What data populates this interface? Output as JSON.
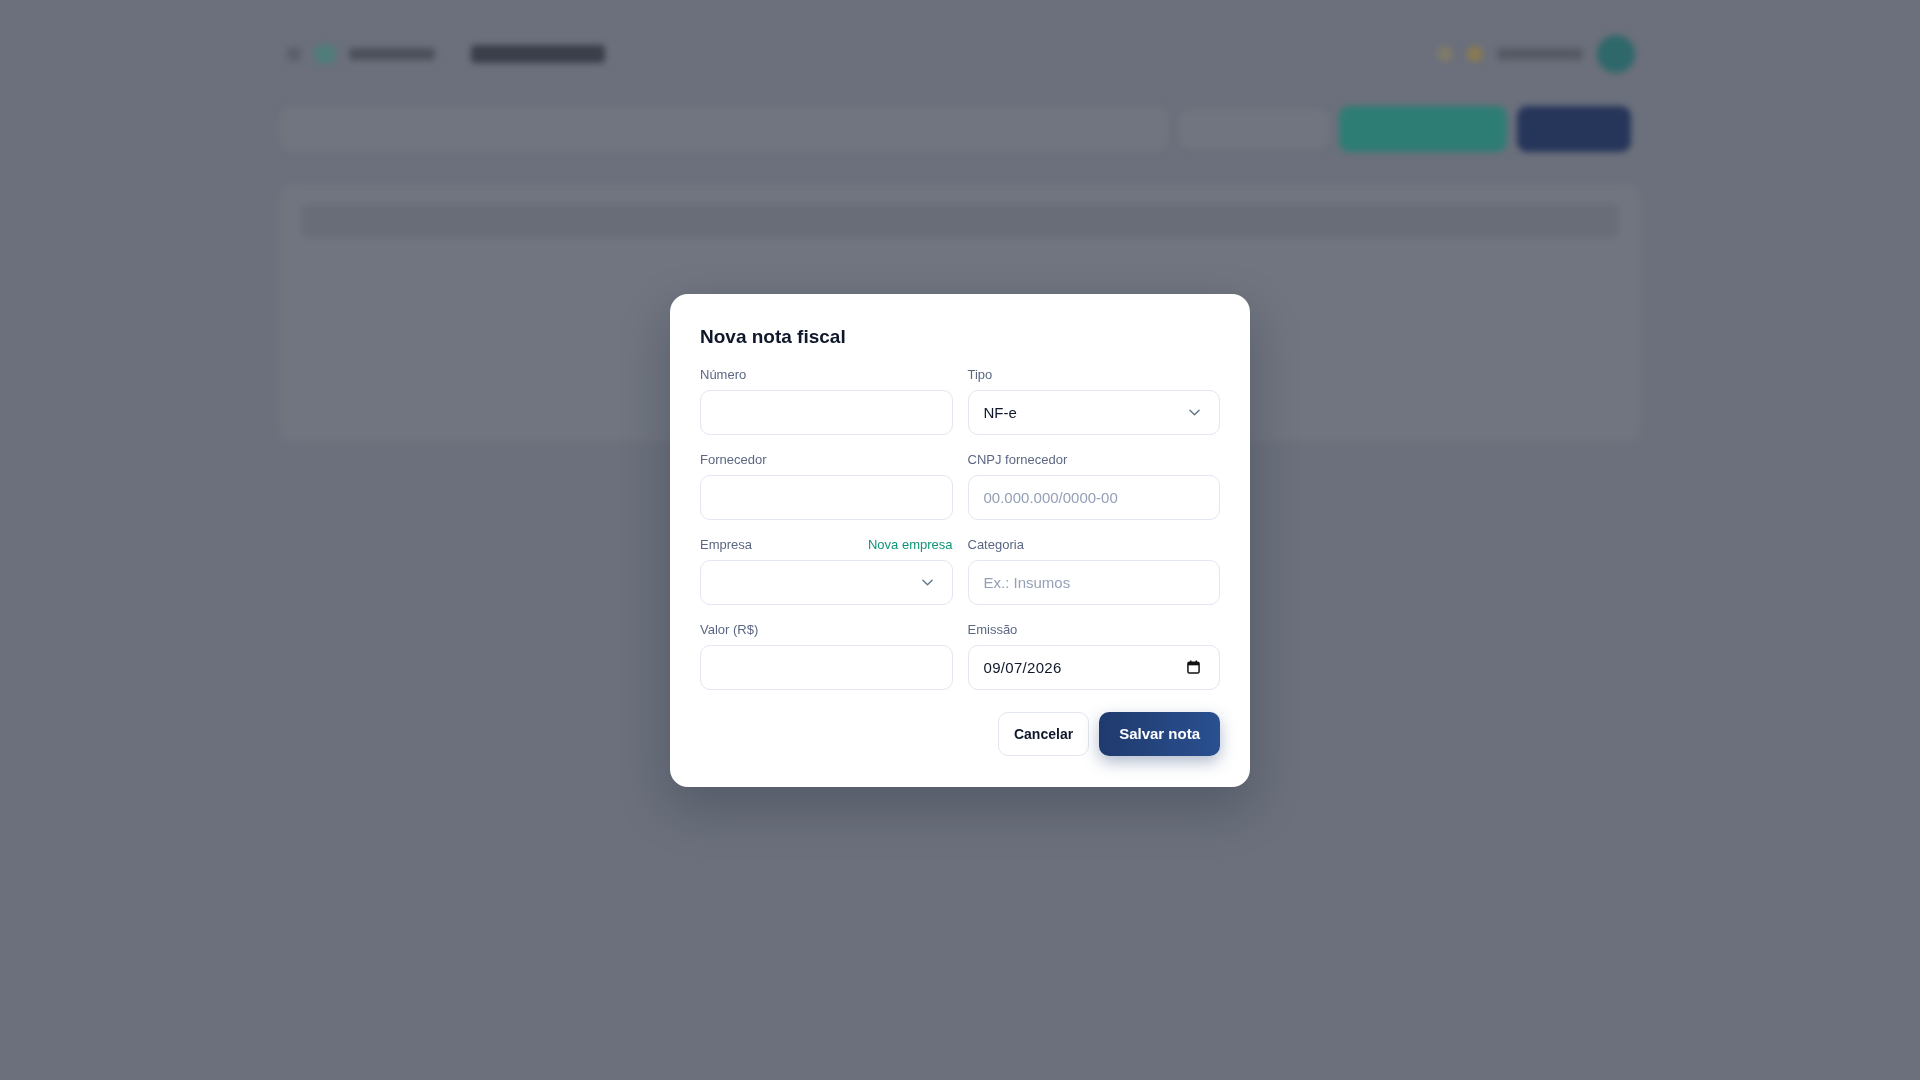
{
  "dialog": {
    "title": "Nova nota fiscal",
    "fields": [
      {
        "label": "Número",
        "kind": "text"
      },
      {
        "label": "Tipo",
        "kind": "select",
        "value": "NF-e"
      },
      {
        "label": "Fornecedor",
        "kind": "text"
      },
      {
        "label": "CNPJ fornecedor",
        "kind": "text",
        "placeholder": "00.000.000/0000-00"
      },
      {
        "label": "Empresa",
        "kind": "select",
        "action_link": "Nova empresa"
      },
      {
        "label": "Categoria",
        "kind": "text",
        "placeholder": "Ex.: Insumos"
      },
      {
        "label": "Valor (R$)",
        "kind": "text"
      },
      {
        "label": "Emissão",
        "kind": "date",
        "value": "09/07/2026"
      }
    ],
    "buttons": [
      {
        "label": "Cancelar",
        "kind": "secondary"
      },
      {
        "label": "Salvar nota",
        "kind": "primary"
      }
    ]
  }
}
